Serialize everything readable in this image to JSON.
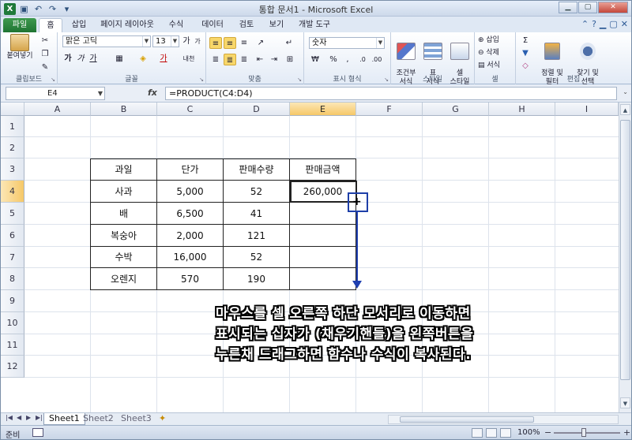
{
  "window": {
    "title": "통합 문서1 - Microsoft Excel"
  },
  "tabs": [
    "파일",
    "홈",
    "삽입",
    "페이지 레이아웃",
    "수식",
    "데이터",
    "검토",
    "보기",
    "개발 도구"
  ],
  "ribbon": {
    "clipboard": {
      "label": "클립보드",
      "paste": "붙여넣기"
    },
    "font": {
      "label": "글꼴",
      "name": "맑은 고딕",
      "size": "13",
      "bold": "가",
      "italic": "가",
      "underline": "가"
    },
    "align": {
      "label": "맞춤"
    },
    "number": {
      "label": "표시 형식",
      "format": "숫자",
      "currency": "₩",
      "percent": "%"
    },
    "styles": {
      "label": "스타일",
      "cond": "조건부\n서식",
      "table": "표\n서식",
      "cell": "셀\n스타일"
    },
    "cells": {
      "label": "셀",
      "insert": "삽입",
      "delete": "삭제",
      "format": "서식"
    },
    "editing": {
      "label": "편집",
      "sort": "정렬 및\n필터",
      "find": "찾기 및\n선택"
    }
  },
  "formula_bar": {
    "name_box": "E4",
    "fx": "fx",
    "formula": "=PRODUCT(C4:D4)"
  },
  "columns": [
    "A",
    "B",
    "C",
    "D",
    "E",
    "F",
    "G",
    "H",
    "I"
  ],
  "rows": [
    "1",
    "2",
    "3",
    "4",
    "5",
    "6",
    "7",
    "8",
    "9",
    "10",
    "11",
    "12"
  ],
  "table": {
    "headers": [
      "과일",
      "단가",
      "판매수량",
      "판매금액"
    ],
    "rows": [
      [
        "사과",
        "5,000",
        "52",
        "260,000"
      ],
      [
        "배",
        "6,500",
        "41",
        ""
      ],
      [
        "복숭아",
        "2,000",
        "121",
        ""
      ],
      [
        "수박",
        "16,000",
        "52",
        ""
      ],
      [
        "오렌지",
        "570",
        "190",
        ""
      ]
    ]
  },
  "fill_handle": "+",
  "caption": [
    "마우스를 셀 오른쪽 하단 모서리로 이동하면",
    "표시되는 십자가 (채우기핸들)을 왼쪽버튼을",
    "누른채 드래그하면 함수나 수식이 복사된다."
  ],
  "sheets": [
    "Sheet1",
    "Sheet2",
    "Sheet3"
  ],
  "status": {
    "ready": "준비",
    "zoom": "100%"
  },
  "accent": "#1f7a3a",
  "annotation_color": "#2040b0"
}
